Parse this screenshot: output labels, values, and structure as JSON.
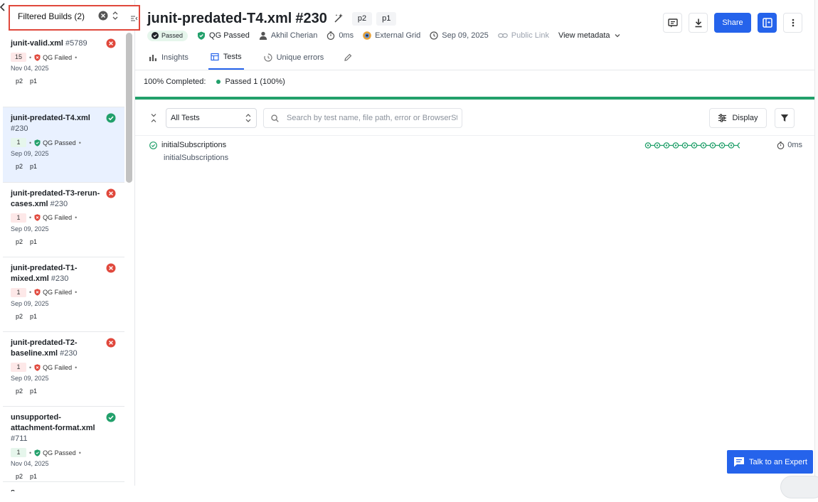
{
  "sidebar": {
    "filter_label": "Filtered Builds (2)",
    "builds": [
      {
        "name": "junit-valid.xml",
        "number": "#5789",
        "status": "failed",
        "count": "15",
        "qg": "QG Failed",
        "date": "Nov 04, 2025",
        "tags": [
          "p2",
          "p1"
        ],
        "selected": false
      },
      {
        "name": "junit-predated-T4.xml",
        "number": "#230",
        "status": "passed",
        "count": "1",
        "qg": "QG Passed",
        "date": "Sep 09, 2025",
        "tags": [
          "p2",
          "p1"
        ],
        "selected": true
      },
      {
        "name": "junit-predated-T3-rerun-cases.xml",
        "number": "#230",
        "status": "failed",
        "count": "1",
        "qg": "QG Failed",
        "date": "Sep 09, 2025",
        "tags": [
          "p2",
          "p1"
        ],
        "selected": false
      },
      {
        "name": "junit-predated-T1-mixed.xml",
        "number": "#230",
        "status": "failed",
        "count": "1",
        "qg": "QG Failed",
        "date": "Sep 09, 2025",
        "tags": [
          "p2",
          "p1"
        ],
        "selected": false
      },
      {
        "name": "junit-predated-T2-baseline.xml",
        "number": "#230",
        "status": "failed",
        "count": "1",
        "qg": "QG Failed",
        "date": "Sep 09, 2025",
        "tags": [
          "p2",
          "p1"
        ],
        "selected": false
      },
      {
        "name": "unsupported-attachment-format.xml",
        "number": "#711",
        "status": "passed",
        "count": "1",
        "qg": "QG Passed",
        "date": "Nov 04, 2025",
        "tags": [
          "p2",
          "p1"
        ],
        "selected": false
      }
    ],
    "partial_item": "s",
    "dot": "•"
  },
  "header": {
    "title": "junit-predated-T4.xml",
    "build_number": "#230",
    "tags": [
      "p2",
      "p1"
    ],
    "share_label": "Share",
    "meta": {
      "status": "Passed",
      "quality_gate": "QG Passed",
      "user": "Akhil Cherian",
      "duration": "0ms",
      "ci": "External Grid",
      "date": "Sep 09, 2025",
      "public_link": "Public Link",
      "view_metadata": "View metadata"
    }
  },
  "tabs": [
    {
      "label": "Insights",
      "icon": "bar-chart-icon",
      "active": false
    },
    {
      "label": "Tests",
      "icon": "table-icon",
      "active": true
    },
    {
      "label": "Unique errors",
      "icon": "clock-icon",
      "active": false
    }
  ],
  "summary": {
    "completed": "100% Completed:",
    "passed": "Passed 1 (100%)",
    "progress": 1.0
  },
  "toolbar": {
    "filter_select": "All Tests",
    "search_placeholder": "Search by test name, file path, error or BrowserStack",
    "display_label": "Display"
  },
  "tests": [
    {
      "name": "initialSubscriptions",
      "sub": "initialSubscriptions",
      "status": "passed",
      "history_count": 12,
      "duration": "0ms"
    }
  ],
  "expert_label": "Talk to an Expert",
  "colors": {
    "accent": "#2563eb",
    "pass": "#22a06b",
    "fail": "#e0483c",
    "selection_outline": "#e0483c"
  },
  "icons": [
    "back-arrow-icon",
    "clear-icon",
    "sort-icon",
    "collapse-sidebar-icon",
    "ai-sparkle-icon",
    "comment-icon",
    "download-icon",
    "copilot-icon",
    "more-icon",
    "user-icon",
    "timer-icon",
    "calendar-icon",
    "link-icon",
    "chevron-down-icon",
    "edit-icon",
    "search-icon",
    "sliders-icon",
    "filter-icon",
    "chat-icon"
  ]
}
